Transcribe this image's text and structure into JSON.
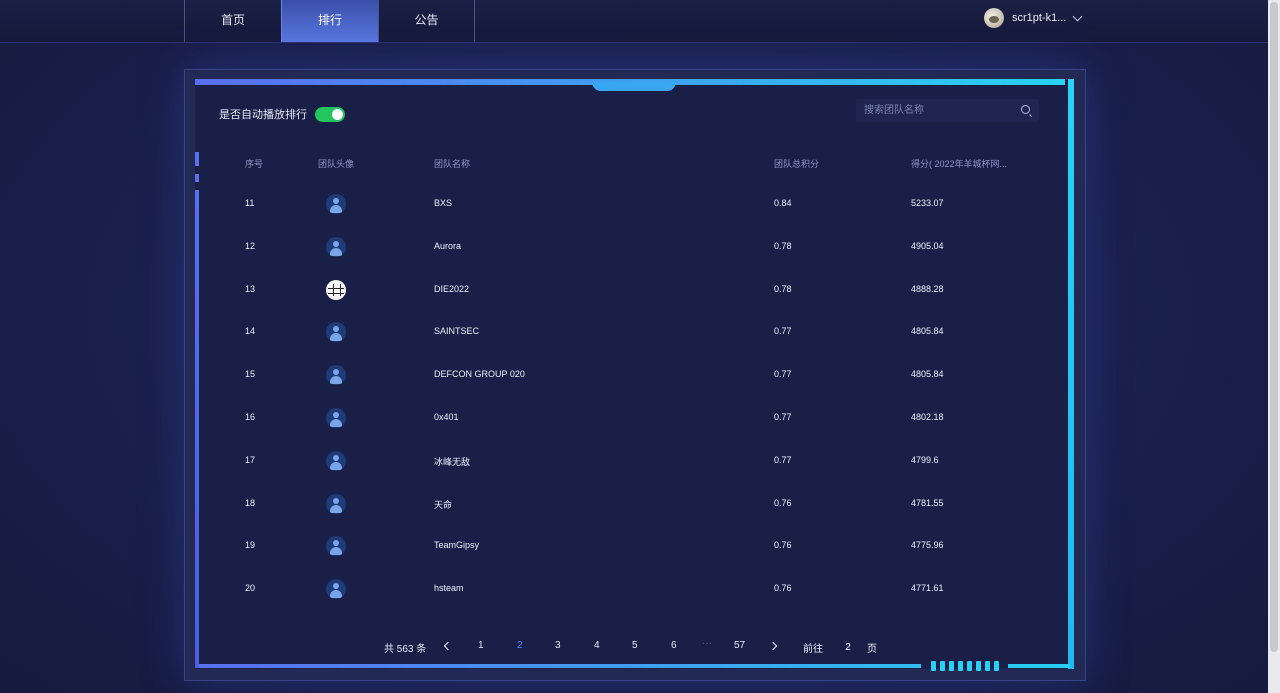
{
  "nav": {
    "items": [
      {
        "label": "首页"
      },
      {
        "label": "排行"
      },
      {
        "label": "公告"
      }
    ]
  },
  "user": {
    "name": "scr1pt-k1..."
  },
  "autoplay": {
    "label": "是否自动播放排行",
    "enabled": true
  },
  "search": {
    "placeholder": "搜索团队名称"
  },
  "table": {
    "headers": {
      "rank": "序号",
      "avatar": "团队头像",
      "name": "团队名称",
      "total": "团队总积分",
      "score": "得分( 2022年羊城杯网..."
    },
    "rows": [
      {
        "rank": "11",
        "name": "BXS",
        "total": "0.84",
        "score": "5233.07",
        "avatar": "default-avatar-icon"
      },
      {
        "rank": "12",
        "name": "Aurora",
        "total": "0.78",
        "score": "4905.04",
        "avatar": "default-avatar-icon"
      },
      {
        "rank": "13",
        "name": "DIE2022",
        "total": "0.78",
        "score": "4888.28",
        "avatar": "team-logo-icon"
      },
      {
        "rank": "14",
        "name": "SAINTSEC",
        "total": "0.77",
        "score": "4805.84",
        "avatar": "default-avatar-icon"
      },
      {
        "rank": "15",
        "name": "DEFCON GROUP 020",
        "total": "0.77",
        "score": "4805.84",
        "avatar": "default-avatar-icon"
      },
      {
        "rank": "16",
        "name": "0x401",
        "total": "0.77",
        "score": "4802.18",
        "avatar": "default-avatar-icon"
      },
      {
        "rank": "17",
        "name": "冰峰无敌",
        "total": "0.77",
        "score": "4799.6",
        "avatar": "default-avatar-icon"
      },
      {
        "rank": "18",
        "name": "天命",
        "total": "0.76",
        "score": "4781.55",
        "avatar": "default-avatar-icon"
      },
      {
        "rank": "19",
        "name": "TeamGipsy",
        "total": "0.76",
        "score": "4775.96",
        "avatar": "default-avatar-icon"
      },
      {
        "rank": "20",
        "name": "hsteam",
        "total": "0.76",
        "score": "4771.61",
        "avatar": "default-avatar-icon"
      }
    ]
  },
  "pagination": {
    "total_label": "共 563 条",
    "pages": [
      "1",
      "2",
      "3",
      "4",
      "5",
      "6"
    ],
    "ellipsis": "···",
    "last_page": "57",
    "current": "2",
    "goto_label": "前往",
    "goto_value": "2",
    "page_suffix": "页"
  },
  "colors": {
    "accent": "#4f86ff",
    "toggle_on": "#22c55e",
    "frame_cyan": "#27d0f5",
    "frame_blue": "#5a6ef0",
    "background": "#1a1f47"
  }
}
